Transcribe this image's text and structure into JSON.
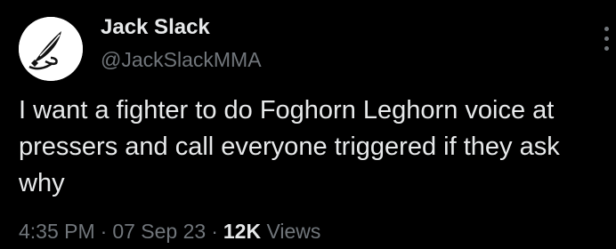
{
  "tweet": {
    "author_name": "Jack Slack",
    "author_handle": "@JackSlackMMA",
    "text": "I want a fighter to do Foghorn Leghorn voice at pressers and call everyone triggered if they ask why",
    "time": "4:35 PM",
    "separator": "·",
    "date": "07 Sep 23",
    "views_count": "12K",
    "views_label": "Views"
  },
  "icons": {
    "avatar": "quill-logo-icon",
    "more": "more-options-icon"
  },
  "colors": {
    "background": "#000000",
    "primary_text": "#e7e9ea",
    "secondary_text": "#71767b"
  }
}
